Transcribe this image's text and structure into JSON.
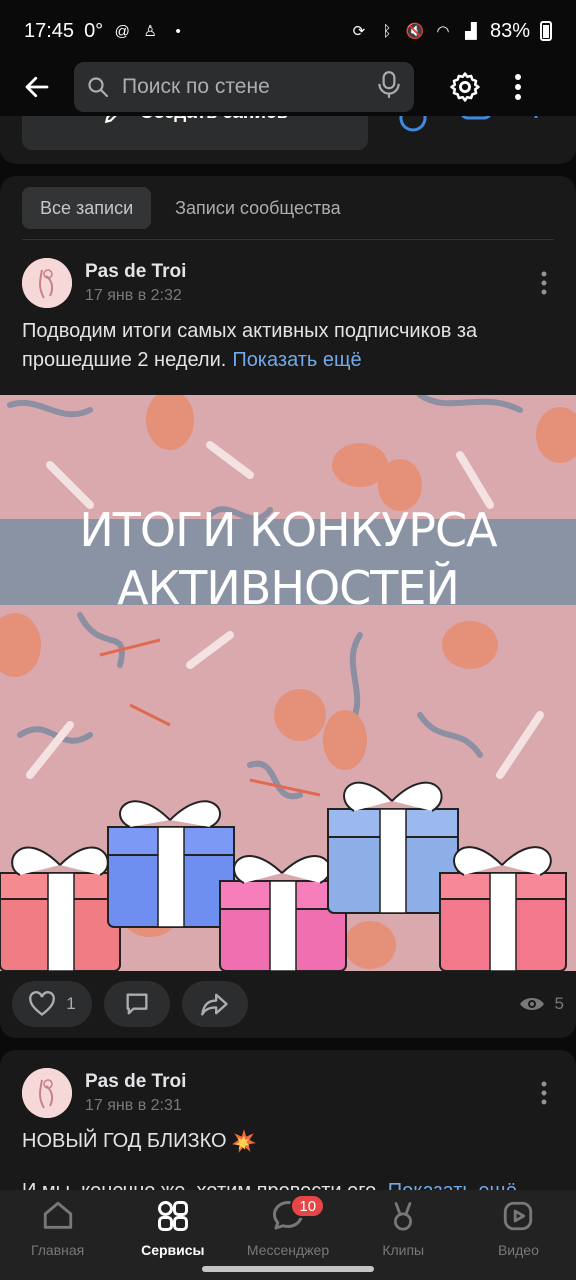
{
  "status_bar": {
    "time": "17:45",
    "temperature": "0°",
    "battery": "83%"
  },
  "top_bar": {
    "search_placeholder": "Поиск по стене"
  },
  "create_post": {
    "label": "Создать запись"
  },
  "tabs": [
    {
      "label": "Все записи",
      "active": true
    },
    {
      "label": "Записи сообщества",
      "active": false
    }
  ],
  "post1": {
    "author": "Pas de Troi",
    "date": "17 янв в 2:32",
    "text": "Подводим итоги самых активных подписчиков за прошедшие 2 недели.",
    "show_more": "Показать ещё",
    "image_title_line1": "ИТОГИ КОНКУРСА",
    "image_title_line2": "АКТИВНОСТЕЙ",
    "likes": "1",
    "views": "5"
  },
  "post2": {
    "author": "Pas de Troi",
    "date": "17 янв в 2:31",
    "text": "НОВЫЙ ГОД БЛИЗКО",
    "text_line2": "И мы, конечно же, хотим провести его",
    "show_more": "Показать ещё"
  },
  "bottom_nav": {
    "items": [
      {
        "label": "Главная",
        "icon": "home-icon"
      },
      {
        "label": "Сервисы",
        "icon": "services-icon"
      },
      {
        "label": "Мессенджер",
        "icon": "messenger-icon",
        "badge": "10"
      },
      {
        "label": "Клипы",
        "icon": "clips-icon"
      },
      {
        "label": "Видео",
        "icon": "video-icon"
      }
    ]
  },
  "colors": {
    "accent": "#71aaeb",
    "background": "#0a0a0a",
    "card": "#191919",
    "badge": "#e64646"
  }
}
